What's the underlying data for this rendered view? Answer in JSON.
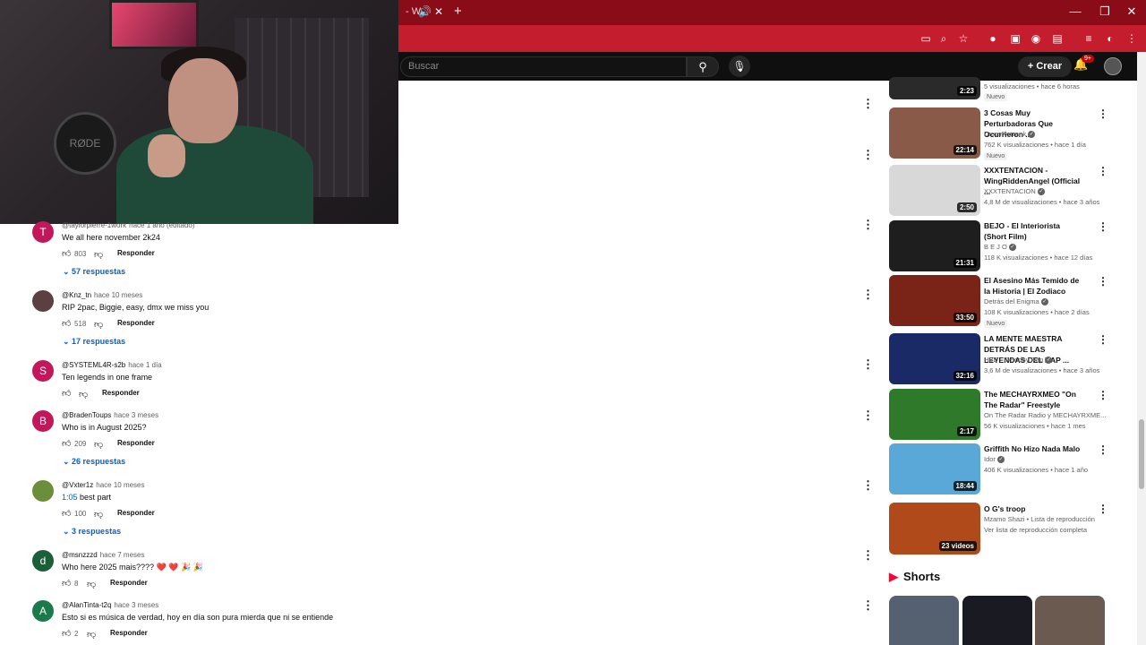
{
  "browser": {
    "tab_fragment": "- W",
    "new_tab": "+",
    "win_controls": [
      "—",
      "❐",
      "✕"
    ]
  },
  "yt": {
    "search_placeholder": "Buscar",
    "create_label": "Crear",
    "notif_count": "9+"
  },
  "comments": [
    {
      "author": "@taylorpierre-1work",
      "time": "hace 1 año (editado)",
      "text": "We all here november 2k24",
      "likes": "803",
      "reply": "Responder",
      "replies": "57 respuestas",
      "avatar_letter": "T",
      "avatar_color": "#c2185b"
    },
    {
      "author": "@Knz_tn",
      "time": "hace 10 meses",
      "text": "RIP 2pac, Biggie, easy, dmx we miss you",
      "likes": "518",
      "reply": "Responder",
      "replies": "17 respuestas",
      "avatar_letter": "",
      "avatar_color": "#5a4040"
    },
    {
      "author": "@SYSTEML4R-s2b",
      "time": "hace 1 día",
      "text": "Ten legends in one frame",
      "likes": "",
      "reply": "Responder",
      "replies": "",
      "avatar_letter": "S",
      "avatar_color": "#c2185b"
    },
    {
      "author": "@BradenToups",
      "time": "hace 3 meses",
      "text": "Who is in August 2025?",
      "likes": "209",
      "reply": "Responder",
      "replies": "26 respuestas",
      "avatar_letter": "B",
      "avatar_color": "#c2185b"
    },
    {
      "author": "@Vxter1z",
      "time": "hace 10 meses",
      "link": "1:05",
      "text": " best part",
      "likes": "100",
      "reply": "Responder",
      "replies": "3 respuestas",
      "avatar_letter": "",
      "avatar_color": "#6b8e3a"
    },
    {
      "author": "@msnzzzd",
      "time": "hace 7 meses",
      "text": "Who here 2025 mais???? ❤️ ❤️ 🎉 🎉",
      "likes": "8",
      "reply": "Responder",
      "replies": "",
      "avatar_letter": "d",
      "avatar_color": "#1b5e3a"
    },
    {
      "author": "@AlanTinta-t2q",
      "time": "hace 3 meses",
      "text": "Esto si es música de verdad, hoy en día son pura mierda que ni se entiende",
      "likes": "2",
      "reply": "Responder",
      "replies": "",
      "avatar_letter": "A",
      "avatar_color": "#1b7a4a"
    }
  ],
  "related": [
    {
      "title": "",
      "meta1": "5 visualizaciones • hace 6 horas",
      "meta2": "",
      "duration": "2:23",
      "new": "Nuevo",
      "thumb": "#2a2a2a"
    },
    {
      "title": "3 Cosas Muy Perturbadoras Que Ocurrieron ...",
      "meta1": "DrossRotzank",
      "meta2": "762 K visualizaciones • hace 1 día",
      "duration": "22:14",
      "new": "Nuevo",
      "thumb": "#8a5a48"
    },
    {
      "title": "XXXTENTACION - WingRiddenAngel (Official ...",
      "meta1": "XXXTENTACION",
      "meta2": "4,8 M de visualizaciones • hace 3 años",
      "duration": "2:50",
      "new": "",
      "thumb": "#d8d8d8"
    },
    {
      "title": "BEJO  - El Interiorista (Short Film)",
      "meta1": "B E J O",
      "meta2": "118 K visualizaciones • hace 12 días",
      "duration": "21:31",
      "new": "",
      "thumb": "#1e1e1e"
    },
    {
      "title": "El Asesino Más Temido de la Historia | El Zodiaco",
      "meta1": "Detrás del Enigma",
      "meta2": "108 K visualizaciones • hace 2 días",
      "duration": "33:50",
      "new": "Nuevo",
      "thumb": "#7a2418"
    },
    {
      "title": "LA MENTE MAESTRA DETRÁS DE LAS LEYENDAS DEL RAP ...",
      "meta1": "HBD - Detodoy Rap",
      "meta2": "3,6 M de visualizaciones • hace 3 años",
      "duration": "32:16",
      "new": "",
      "thumb": "#1a2a66"
    },
    {
      "title": "The MECHAYRXMEO \"On The Radar\" Freestyle",
      "meta1": "On The Radar Radio  y MECHAYRXME...",
      "meta2": "56 K visualizaciones • hace 1 mes",
      "duration": "2:17",
      "new": "",
      "thumb": "#2e7a2a"
    },
    {
      "title": "Griffith No Hizo Nada Malo",
      "meta1": "Idor",
      "meta2": "406 K visualizaciones • hace 1 año",
      "duration": "18:44",
      "new": "",
      "thumb": "#5aa8d8"
    },
    {
      "title": "O G's troop",
      "meta1": "Mzamo Shazi • Lista de reproducción",
      "meta2": "Ver lista de reproducción completa",
      "duration": "23 videos",
      "new": "",
      "thumb": "#b04a1a"
    }
  ],
  "shorts": {
    "title": "Shorts",
    "thumbs": [
      "#556070",
      "#1a1a22",
      "#6a5a50"
    ]
  }
}
